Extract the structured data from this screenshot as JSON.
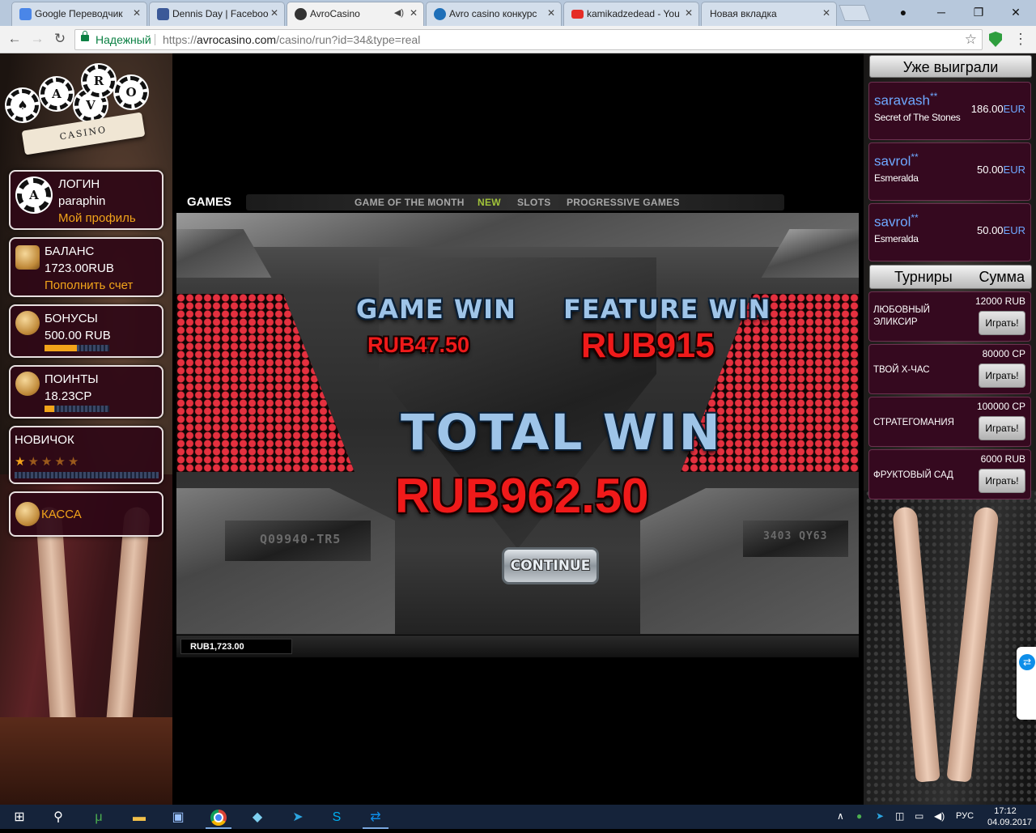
{
  "browser": {
    "tabs": [
      {
        "title": "Google Переводчик",
        "icon": "google-translate-icon",
        "color": "#4a86e8"
      },
      {
        "title": "Dennis Day | Faceboo",
        "icon": "facebook-icon",
        "color": "#3b5998"
      },
      {
        "title": "AvroCasino",
        "icon": "avrocasino-icon",
        "color": "#333333",
        "active": true
      },
      {
        "title": "Avro casino конкурс",
        "icon": "kp-icon",
        "color": "#1e6fb8"
      },
      {
        "title": "kamikadzedead - You",
        "icon": "youtube-icon",
        "color": "#e52d27"
      },
      {
        "title": "Новая вкладка",
        "icon": "",
        "color": ""
      }
    ],
    "secure_label": "Надежный",
    "url_prefix": "https://",
    "url_host": "avrocasino.com",
    "url_path": "/casino/run?id=34&type=real"
  },
  "sidebar_left": {
    "logo": {
      "letters": [
        "A",
        "V",
        "R",
        "O"
      ],
      "ribbon": "CASINO"
    },
    "login": {
      "label": "ЛОГИН",
      "username": "paraphin",
      "profile_link": "Мой профиль"
    },
    "balance": {
      "label": "БАЛАНС",
      "value": "1723.00RUB",
      "topup_link": "Пополнить счет"
    },
    "bonuses": {
      "label": "БОНУСЫ",
      "value": "500.00 RUB",
      "progress": 0.5
    },
    "points": {
      "label": "ПОИНТЫ",
      "value": "18.23CP",
      "progress": 0.15
    },
    "rank": {
      "label": "НОВИЧОК",
      "stars_total": 5,
      "stars_on": 1
    },
    "cashier": {
      "label": "КАССА"
    }
  },
  "games_nav": {
    "title": "GAMES",
    "tabs": [
      "GAME OF THE MONTH",
      "NEW",
      "SLOTS",
      "PROGRESSIVE GAMES"
    ],
    "current": "NEW"
  },
  "slot": {
    "game_win_label": "GAME WIN",
    "game_win_value": "RUB47.50",
    "feature_win_label": "FEATURE WIN",
    "feature_win_value": "RUB915",
    "total_win_label": "TOTAL WIN",
    "total_win_value": "RUB962.50",
    "continue_label": "CONTINUE",
    "stencil_left": "Q09940-TR5",
    "stencil_right": "3403 QY63",
    "balance": "RUB1,723.00",
    "colors": {
      "win_red": "#f01a1a",
      "label_blue": "#9ec4e8"
    }
  },
  "sidebar_right": {
    "winners_header": "Уже выиграли",
    "winners": [
      {
        "user": "saravash",
        "mark": "**",
        "game": "Secret of The Stones",
        "amount": "186.00",
        "currency": "EUR"
      },
      {
        "user": "savrol",
        "mark": "**",
        "game": "Esmeralda",
        "amount": "50.00",
        "currency": "EUR"
      },
      {
        "user": "savrol",
        "mark": "**",
        "game": "Esmeralda",
        "amount": "50.00",
        "currency": "EUR"
      }
    ],
    "tournaments_header_left": "Турниры",
    "tournaments_header_right": "Сумма",
    "tournaments": [
      {
        "name": "ЛЮБОВНЫЙ ЭЛИКСИР",
        "prize": "12000 RUB",
        "button": "Играть!"
      },
      {
        "name": "ТВОЙ Х-ЧАС",
        "prize": "80000 CP",
        "button": "Играть!"
      },
      {
        "name": "СТРАТЕГОМАНИЯ",
        "prize": "100000 CP",
        "button": "Играть!"
      },
      {
        "name": "ФРУКТОВЫЙ САД",
        "prize": "6000 RUB",
        "button": "Играть!"
      }
    ]
  },
  "taskbar": {
    "lang": "РУС",
    "time": "17:12",
    "date": "04.09.2017"
  }
}
